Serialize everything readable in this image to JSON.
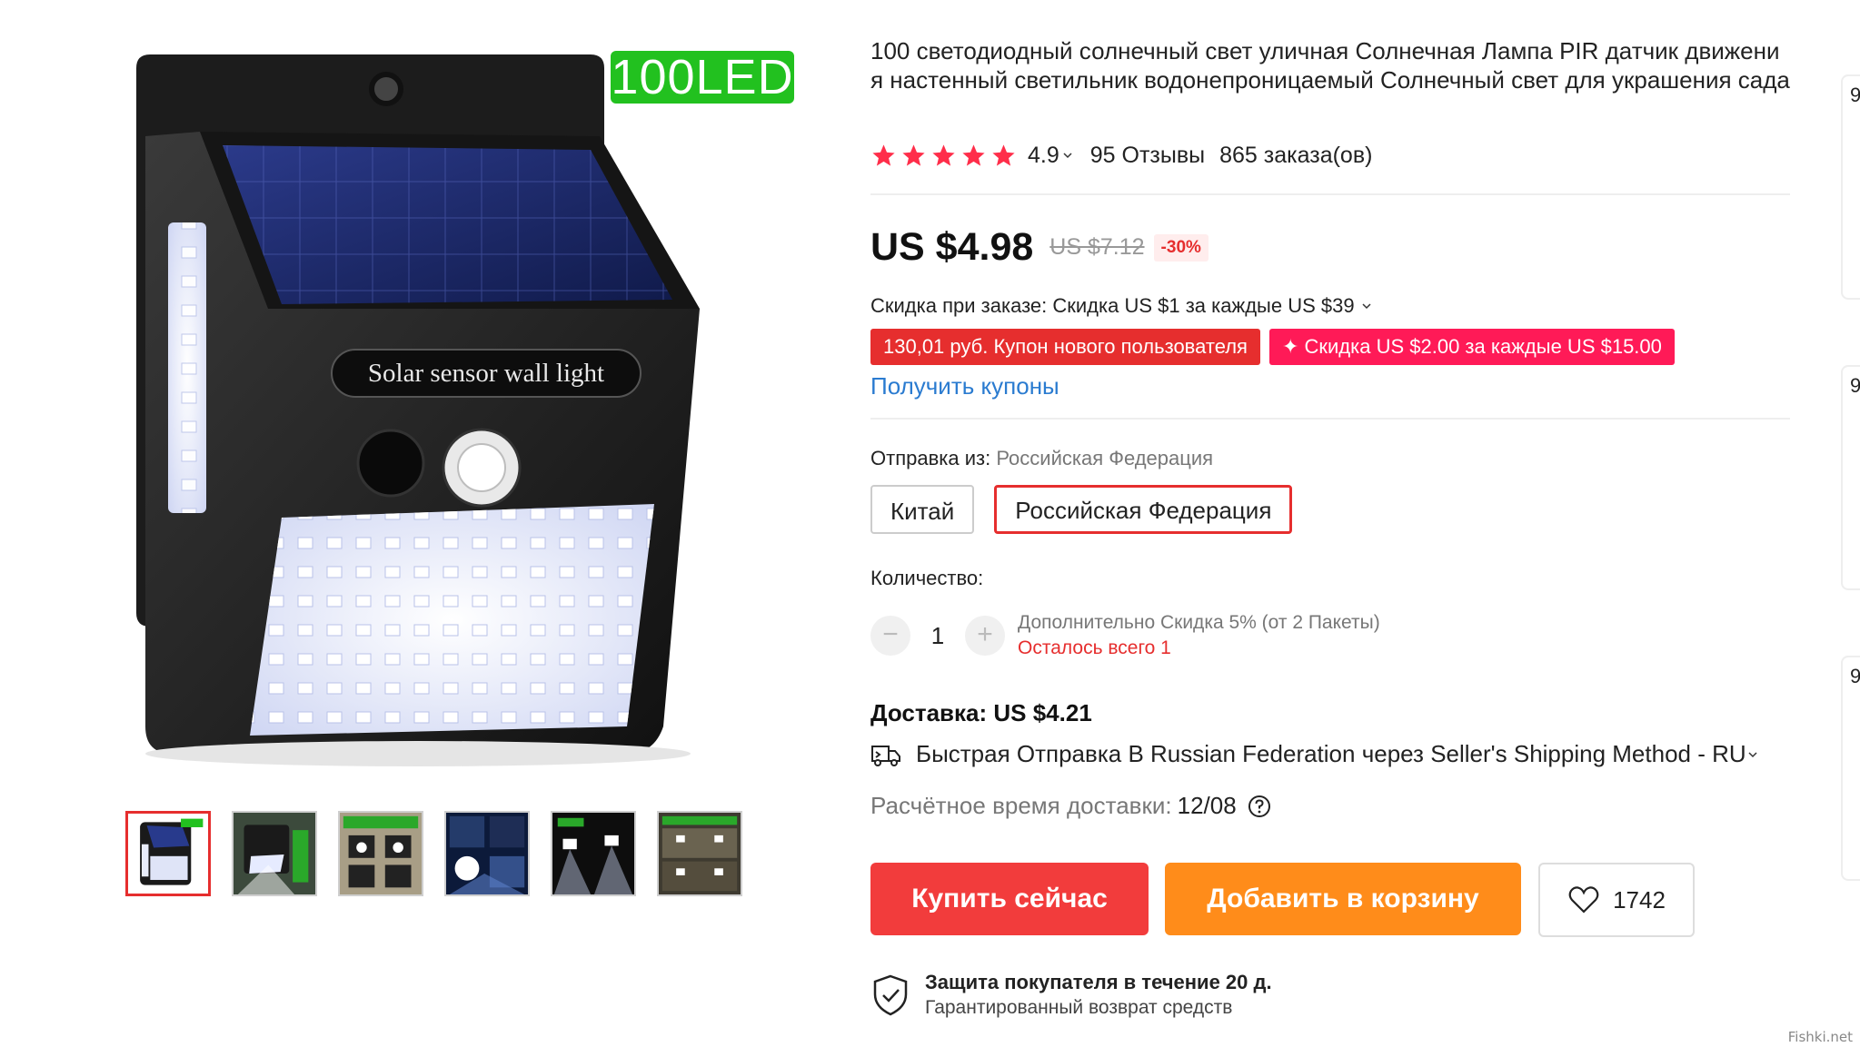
{
  "gallery": {
    "badge_text": "100LED",
    "product_caption": "Solar sensor wall light",
    "thumbnails": [
      "thumb-1",
      "thumb-2",
      "thumb-3",
      "thumb-4",
      "thumb-5",
      "thumb-6"
    ],
    "active_thumbnail": 0
  },
  "product": {
    "title": "100 светодиодный солнечный свет уличная Солнечная Лампа PIR датчик движения настенный светильник водонепроницаемый Солнечный свет для украшения сада",
    "rating": "4.9",
    "reviews": "95 Отзывы",
    "orders": "865 заказа(ов)"
  },
  "price": {
    "current": "US $4.98",
    "old": "US $7.12",
    "discount": "-30%"
  },
  "order_discount": "Скидка при заказе: Скидка US $1 за каждые US $39",
  "coupons": [
    {
      "text": "130,01 руб. Купон нового пользователя",
      "color": "#e62e2e"
    },
    {
      "text": "✦ Скидка US $2.00 за каждые US $15.00",
      "color": "#ff1a57"
    }
  ],
  "get_coupons": "Получить купоны",
  "shipping": {
    "from_label": "Отправка из:",
    "from_value": "Российская Федерация",
    "options": [
      "Китай",
      "Российская Федерация"
    ],
    "selected": 1
  },
  "quantity": {
    "label": "Количество:",
    "minus": "−",
    "value": "1",
    "plus": "+",
    "extra_discount": "Дополнительно Скидка 5% (от 2 Пакеты)",
    "stock_left": "Осталось всего 1"
  },
  "delivery": {
    "price": "Доставка: US $4.21",
    "method": "Быстрая Отправка  В Russian Federation через Seller's Shipping Method - RU",
    "time_label": "Расчётное время доставки:",
    "time_value": "12/08"
  },
  "actions": {
    "buy": "Купить сейчас",
    "cart": "Добавить в корзину",
    "wishlist_count": "1742"
  },
  "protection": {
    "title": "Защита покупателя в течение 20 д.",
    "subtitle": "Гарантированный возврат средств"
  },
  "edge_cards": [
    "9",
    "9",
    "9"
  ],
  "watermark": "Fishki.net",
  "colors": {
    "accent_red": "#e62e2e",
    "coupon_pink": "#ff1a57",
    "cart_orange": "#ff8c1a",
    "link_blue": "#2a7bd0",
    "led_badge_green": "#22c11f"
  }
}
